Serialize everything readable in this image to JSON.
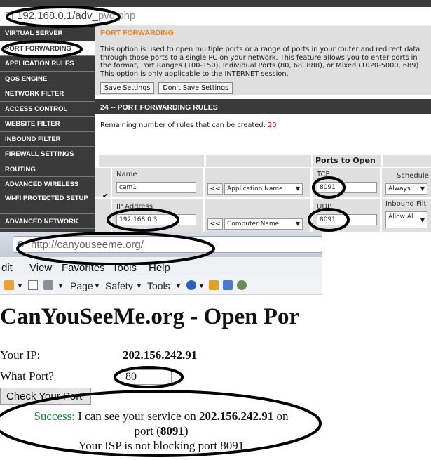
{
  "router": {
    "url": "192.168.0.1/adv_",
    "url_tail": "p",
    "url_end": "vd.php",
    "sidebar": [
      {
        "label": "VIRTUAL SERVER"
      },
      {
        "label": "PORT FORWARDING"
      },
      {
        "label": "APPLICATION RULES"
      },
      {
        "label": "QOS ENGINE"
      },
      {
        "label": "NETWORK FILTER"
      },
      {
        "label": "ACCESS CONTROL"
      },
      {
        "label": "WEBSITE FILTER"
      },
      {
        "label": "INBOUND FILTER"
      },
      {
        "label": "FIREWALL SETTINGS"
      },
      {
        "label": "ROUTING"
      },
      {
        "label": "ADVANCED WIRELESS"
      },
      {
        "label": "WI-FI PROTECTED SETUP"
      },
      {
        "label": "ADVANCED NETWORK"
      }
    ],
    "section_title": "PORT FORWARDING",
    "description": [
      "This option is used to open multiple ports or a range of ports in your router and redirect data",
      "through those ports to a single PC on your network. This feature allows you to enter ports in",
      "the format, Port Ranges (100-150), Individual Ports (80, 68, 888), or Mixed (1020-5000, 689)",
      "This option is only applicable to the INTERNET session."
    ],
    "save_button": "Save Settings",
    "dont_save_button": "Don't Save Settings",
    "rules_title": "24 -- PORT FORWARDING RULES",
    "remaining_label": "Remaining number of rules that can be created:",
    "remaining_count": "20",
    "ports_to_open": "Ports to Open",
    "name_label": "Name",
    "name_value": "cam1",
    "app_name_btn": "<<",
    "app_name_select": "Application Name",
    "tcp_label": "TCP",
    "tcp_value": "8091",
    "schedule_label": "Schedule",
    "schedule_value": "Always",
    "ip_label": "IP Address",
    "ip_value": "192.168.0.3",
    "computer_btn": "<<",
    "computer_select": "Computer Name",
    "udp_label": "UDP",
    "udp_value": "8091",
    "inbound_label": "Inbound Filt",
    "inbound_value": "Allow Al"
  },
  "browser": {
    "url": "http://canyouseeme.org/",
    "menu": [
      "dit",
      "View",
      "Favorites",
      "Tools",
      "Help"
    ],
    "toolbar": {
      "page": "Page",
      "safety": "Safety",
      "tools": "Tools"
    },
    "title": "CanYouSeeMe.org - Open Por",
    "ip_label": "Your IP:",
    "ip_value": "202.156.242.91",
    "port_label": "What Port?",
    "port_value": "80",
    "check_button": "Check Your Port",
    "result_ok": "Success:",
    "result_line1": " I can see your service on ",
    "result_ip": "202.156.242.91",
    "result_on": " on",
    "result_port_pre": "port (",
    "result_port": "8091",
    "result_port_post": ")",
    "result_line3": "Your ISP is not blocking port 8091"
  },
  "colors": {
    "accent_orange": "#ff7f00",
    "sidebar_bg": "#3a3a3a",
    "success_green": "#0a8a2a",
    "annotation": "#000000"
  }
}
